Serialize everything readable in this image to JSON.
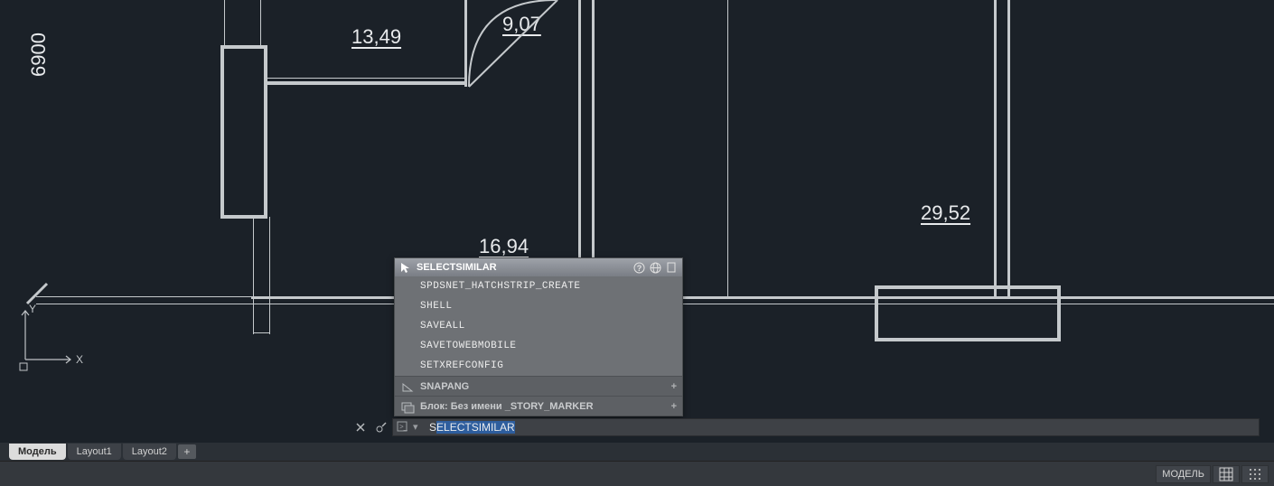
{
  "canvas": {
    "dim_13_49": "13,49",
    "dim_9_07": "9,07",
    "dim_16_94": "16,94",
    "dim_29_52": "29,52",
    "dim_6900": "6900"
  },
  "autocomplete": {
    "title": "SELECTSIMILAR",
    "items": [
      "SPDSNET_HATCHSTRIP_CREATE",
      "SHELL",
      "SAVEALL",
      "SAVETOWEBMOBILE",
      "SETXREFCONFIG"
    ],
    "sections": [
      {
        "label": "SNAPANG"
      },
      {
        "label": "Блок: Без имени _STORY_MARKER"
      }
    ]
  },
  "commandline": {
    "chevron": "▾",
    "typed_char": "S",
    "highlighted": "ELECTSIMILAR"
  },
  "tabs": {
    "items": [
      "Модель",
      "Layout1",
      "Layout2"
    ],
    "active_index": 0,
    "plus": "+"
  },
  "statusbar": {
    "model_btn": "МОДЕЛЬ"
  }
}
